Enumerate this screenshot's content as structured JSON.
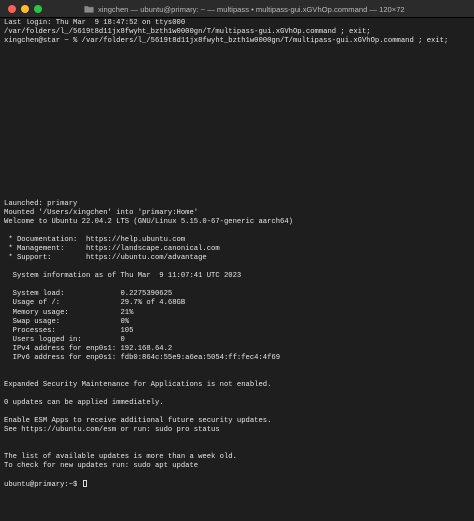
{
  "window": {
    "title": "xingchen — ubuntu@primary: ~ — multipass • multipass-gui.xGVhOp.command — 120×72",
    "title_icon": "folder-icon"
  },
  "terminal": {
    "lines": [
      "Last login: Thu Mar  9 18:47:52 on ttys000",
      "/var/folders/l_/5619t8d11jx8fwyht_bzth1w0000gn/T/multipass-gui.xGVhOp.command ; exit;",
      "xingchen@star ~ % /var/folders/l_/5619t8d11jx8fwyht_bzth1w0000gn/T/multipass-gui.xGVhOp.command ; exit;",
      "",
      "",
      "",
      "",
      "",
      "",
      "",
      "",
      "",
      "",
      "",
      "",
      "",
      "",
      "",
      "",
      "",
      "Launched: primary",
      "Mounted '/Users/xingchen' into 'primary:Home'",
      "Welcome to Ubuntu 22.04.2 LTS (GNU/Linux 5.15.0-67-generic aarch64)",
      "",
      " * Documentation:  https://help.ubuntu.com",
      " * Management:     https://landscape.canonical.com",
      " * Support:        https://ubuntu.com/advantage",
      "",
      "  System information as of Thu Mar  9 11:07:41 UTC 2023",
      "",
      "  System load:             0.2275390625",
      "  Usage of /:              29.7% of 4.68GB",
      "  Memory usage:            21%",
      "  Swap usage:              0%",
      "  Processes:               105",
      "  Users logged in:         0",
      "  IPv4 address for enp0s1: 192.168.64.2",
      "  IPv6 address for enp0s1: fdb0:864c:55e9:a6ea:5054:ff:fec4:4f69",
      "",
      "",
      "Expanded Security Maintenance for Applications is not enabled.",
      "",
      "0 updates can be applied immediately.",
      "",
      "Enable ESM Apps to receive additional future security updates.",
      "See https://ubuntu.com/esm or run: sudo pro status",
      "",
      "",
      "The list of available updates is more than a week old.",
      "To check for new updates run: sudo apt update",
      ""
    ],
    "prompt": "ubuntu@primary:~$ "
  }
}
